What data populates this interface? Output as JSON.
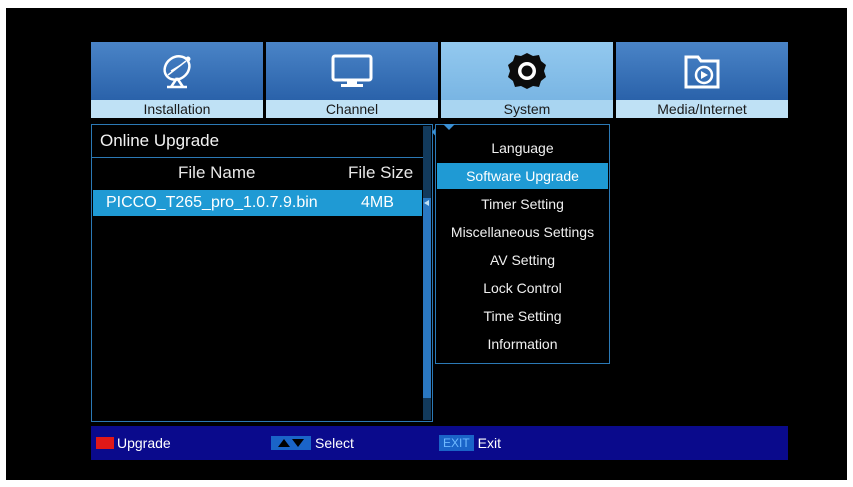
{
  "tabs": [
    {
      "label": "Installation",
      "icon": "satellite-dish-icon"
    },
    {
      "label": "Channel",
      "icon": "tv-icon"
    },
    {
      "label": "System",
      "icon": "gear-icon",
      "active": true
    },
    {
      "label": "Media/Internet",
      "icon": "media-folder-icon"
    }
  ],
  "upgrade_panel": {
    "title": "Online Upgrade",
    "col_file_name": "File Name",
    "col_file_size": "File Size",
    "rows": [
      {
        "file_name": "PICCO_T265_pro_1.0.7.9.bin",
        "file_size": "4MB",
        "selected": true
      }
    ]
  },
  "system_menu": {
    "items": [
      {
        "label": "Language"
      },
      {
        "label": "Software Upgrade",
        "selected": true
      },
      {
        "label": "Timer Setting"
      },
      {
        "label": "Miscellaneous Settings"
      },
      {
        "label": "AV Setting"
      },
      {
        "label": "Lock Control"
      },
      {
        "label": "Time Setting"
      },
      {
        "label": "Information"
      }
    ]
  },
  "footer": {
    "upgrade_label": "Upgrade",
    "select_label": "Select",
    "exit_key": "EXIT",
    "exit_label": "Exit"
  },
  "colors": {
    "selection": "#1f9ad4",
    "border": "#2b79b5",
    "footer_bg": "#0a0a8c",
    "tab_active": "#a9d5f1"
  }
}
